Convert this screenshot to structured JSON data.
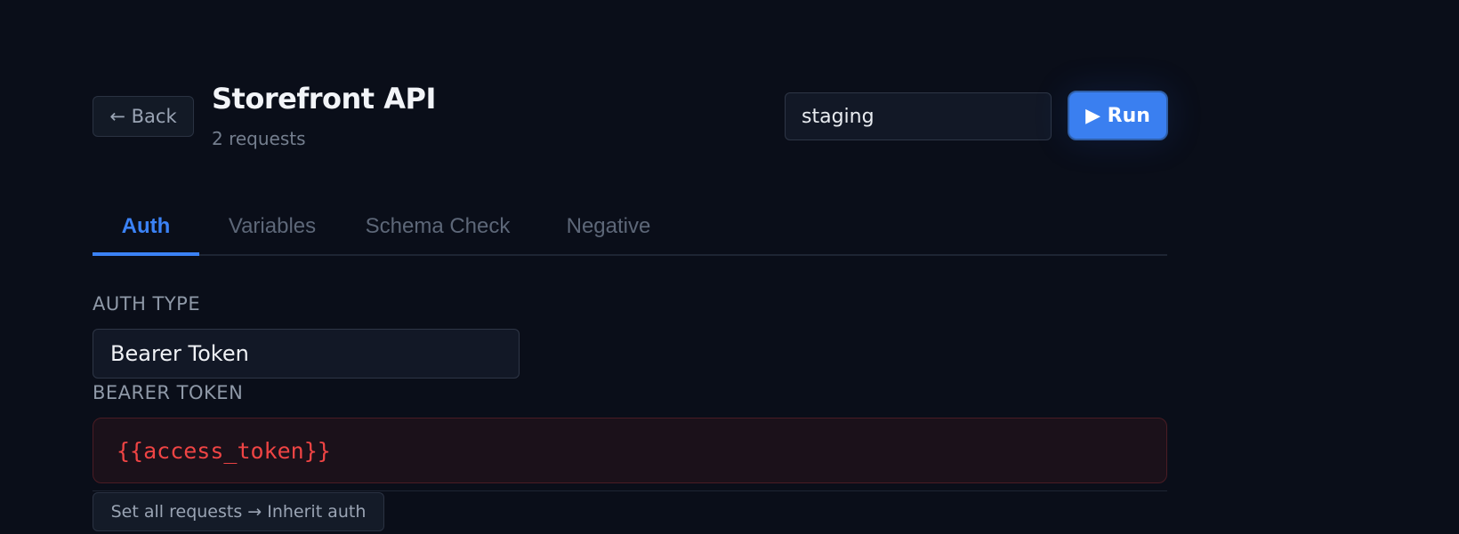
{
  "header": {
    "back_label": "← Back",
    "title": "Storefront API",
    "subtitle": "2 requests",
    "environment_value": "staging",
    "run_label": "▶ Run"
  },
  "tabs": [
    {
      "label": "Auth",
      "active": true
    },
    {
      "label": "Variables",
      "active": false
    },
    {
      "label": "Schema Check",
      "active": false
    },
    {
      "label": "Negative",
      "active": false
    }
  ],
  "auth": {
    "type_label": "AUTH TYPE",
    "type_value": "Bearer Token",
    "token_label": "BEARER TOKEN",
    "token_value": "{{access_token}}",
    "inherit_label": "Set all requests → Inherit auth"
  },
  "colors": {
    "background": "#0a0e19",
    "accent": "#3b82f6",
    "error": "#ef4444"
  }
}
